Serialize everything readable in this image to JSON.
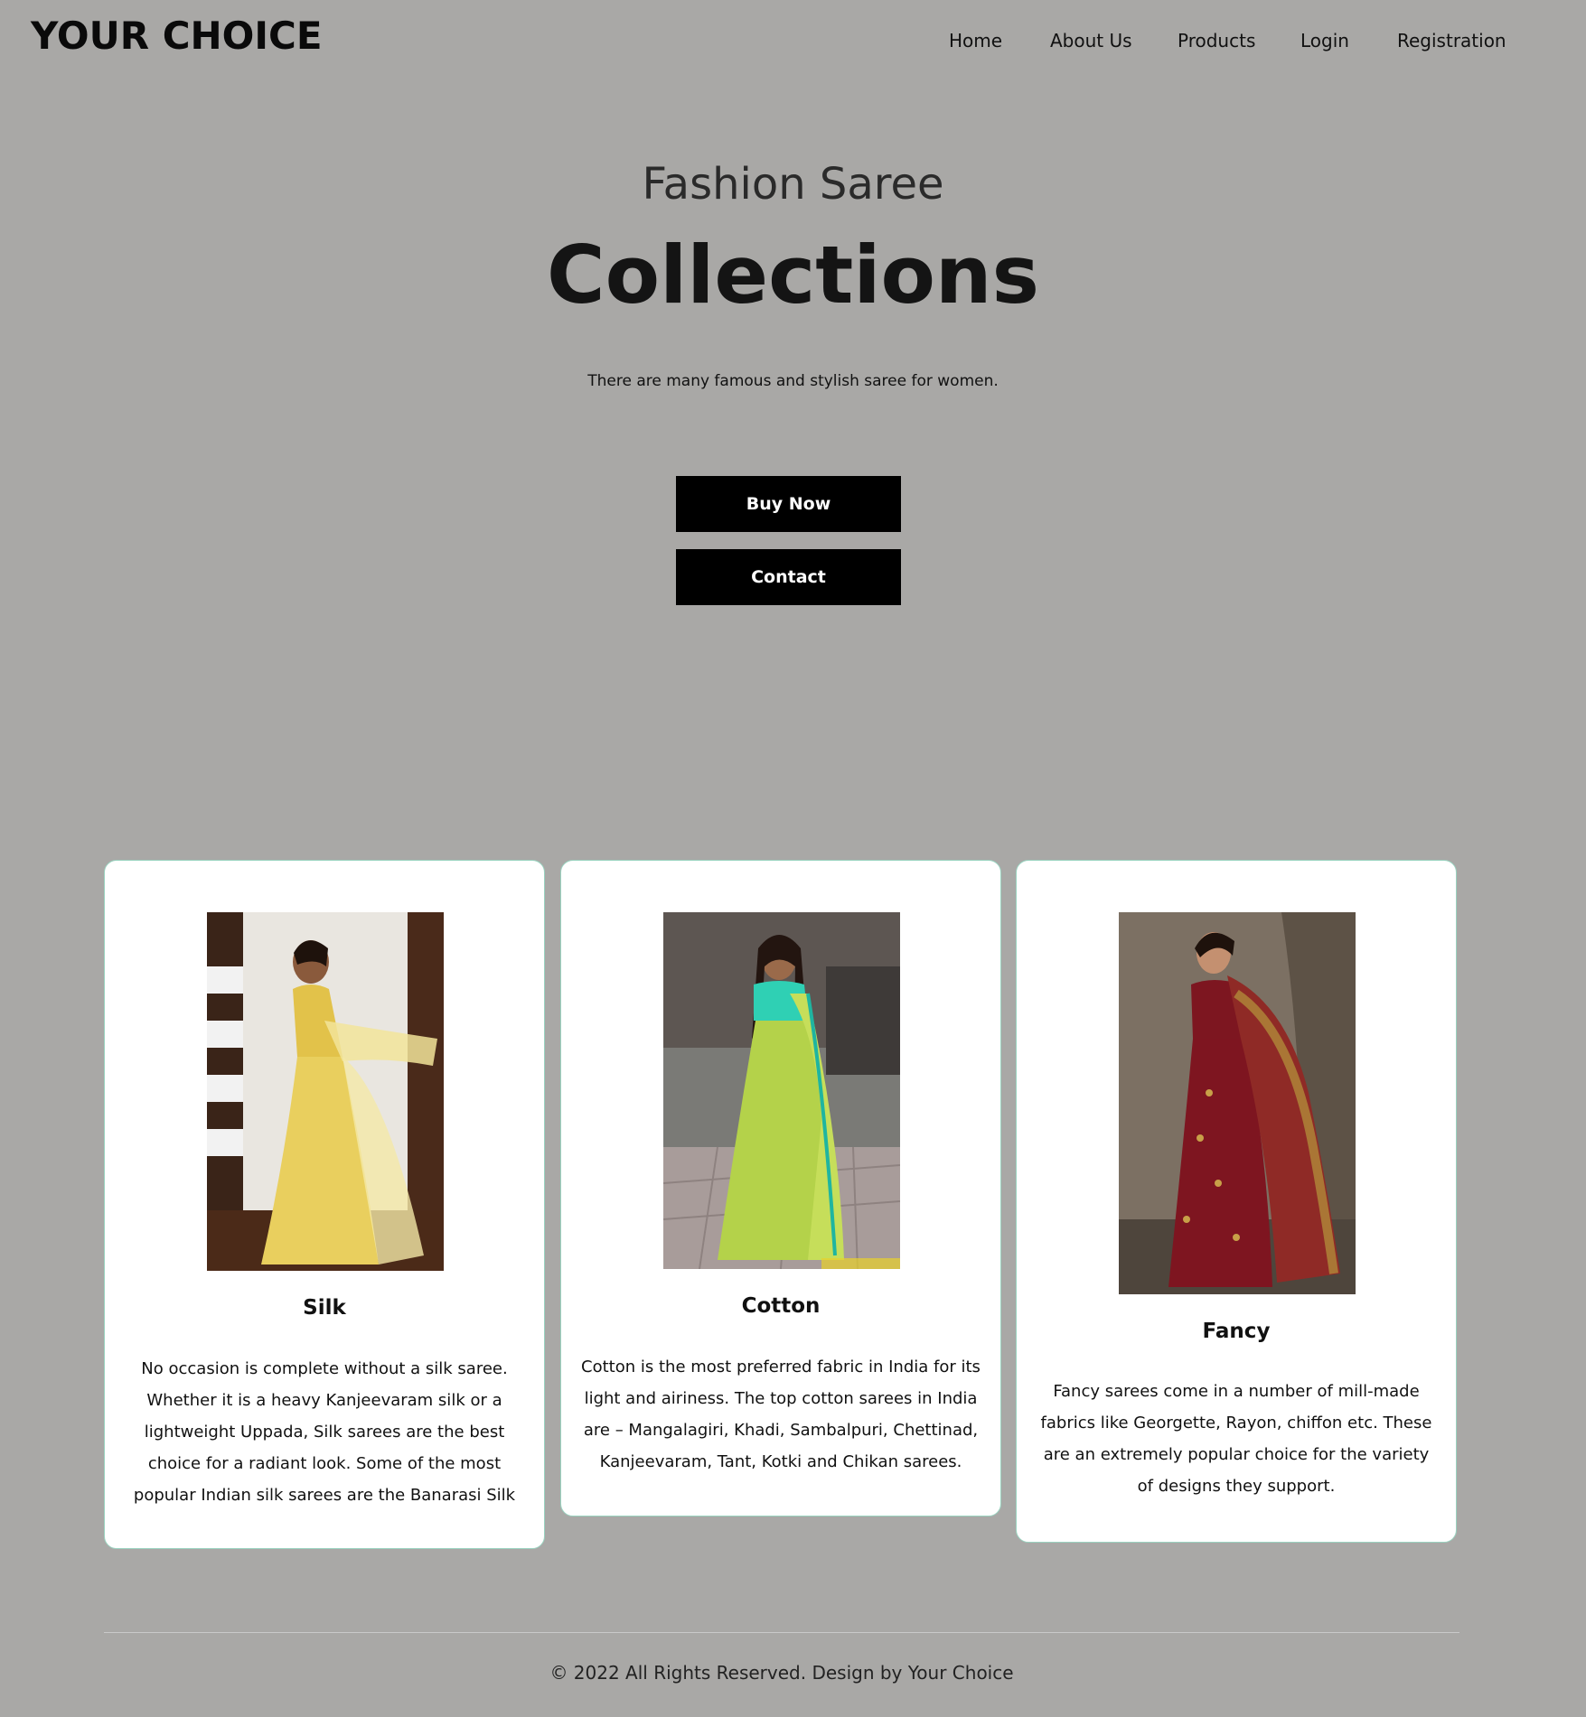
{
  "header": {
    "logo": "YOUR CHOICE",
    "nav": [
      "Home",
      "About Us",
      "Products",
      "Login",
      "Registration"
    ]
  },
  "hero": {
    "subtitle": "Fashion Saree",
    "title": "Collections",
    "description": "There are many famous and stylish saree for women.",
    "buy_label": "Buy Now",
    "contact_label": "Contact"
  },
  "cards": [
    {
      "title": "Silk",
      "text": "No occasion is complete without a silk saree. Whether it is a heavy Kanjeevaram silk or a lightweight Uppada, Silk sarees are the best choice for a radiant look. Some of the most popular Indian silk sarees are the Banarasi Silk"
    },
    {
      "title": "Cotton",
      "text": "Cotton is the most preferred fabric in India for its light and airiness. The top cotton sarees in India are – Mangalagiri, Khadi, Sambalpuri, Chettinad, Kanjeevaram, Tant, Kotki and Chikan sarees."
    },
    {
      "title": "Fancy",
      "text": "Fancy sarees come in a number of mill-made fabrics like Georgette, Rayon, chiffon etc. These are an extremely popular choice for the variety of designs they support."
    }
  ],
  "footer": {
    "text": "© 2022 All Rights Reserved. Design by Your Choice"
  },
  "colors": {
    "background": "#a9a8a6",
    "button": "#000000",
    "card": "#ffffff",
    "card_border": "#9ad3c0"
  }
}
